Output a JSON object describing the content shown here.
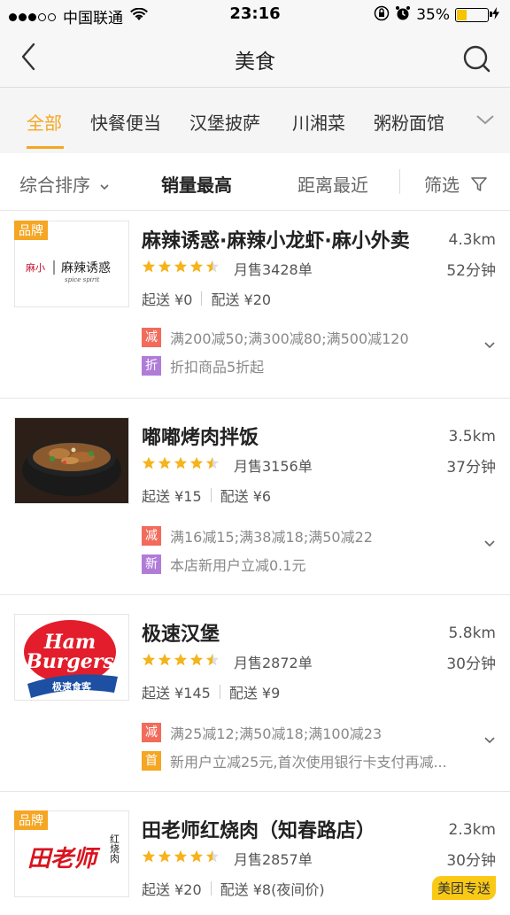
{
  "status_bar": {
    "carrier": "中国联通",
    "time": "23:16",
    "battery": "35%",
    "battery_level": 0.35
  },
  "nav": {
    "title": "美食"
  },
  "categories": [
    "全部",
    "快餐便当",
    "汉堡披萨",
    "川湘菜",
    "粥粉面馆"
  ],
  "sort": {
    "comprehensive": "综合排序",
    "sales": "销量最高",
    "distance": "距离最近",
    "filter": "筛选"
  },
  "brand_label": "品牌",
  "restaurants": [
    {
      "name": "麻辣诱惑·麻辣小龙虾·麻小外卖",
      "distance": "4.3km",
      "time": "52分钟",
      "sales": "月售3428单",
      "min_order": "起送 ¥0",
      "delivery_fee": "配送 ¥20",
      "rating": 4.5,
      "brand": true,
      "logo": {
        "left_text": "麻小",
        "right_text": "麻辣诱惑",
        "sub_text": "spice spirit"
      },
      "promos": [
        {
          "tag": "减",
          "color": "red",
          "text": "满200减50;满300减80;满500减120"
        },
        {
          "tag": "折",
          "color": "purple",
          "text": "折扣商品5折起"
        }
      ]
    },
    {
      "name": "嘟嘟烤肉拌饭",
      "distance": "3.5km",
      "time": "37分钟",
      "sales": "月售3156单",
      "min_order": "起送 ¥15",
      "delivery_fee": "配送 ¥6",
      "rating": 4.5,
      "brand": false,
      "promos": [
        {
          "tag": "减",
          "color": "red",
          "text": "满16减15;满38减18;满50减22"
        },
        {
          "tag": "新",
          "color": "purple",
          "text": "本店新用户立减0.1元"
        }
      ]
    },
    {
      "name": "极速汉堡",
      "distance": "5.8km",
      "time": "30分钟",
      "sales": "月售2872单",
      "min_order": "起送 ¥145",
      "delivery_fee": "配送 ¥9",
      "rating": 4.5,
      "brand": false,
      "logo": {
        "line1": "Ham",
        "line2": "Burgers",
        "line3": "极速食客"
      },
      "promos": [
        {
          "tag": "减",
          "color": "red",
          "text": "满25减12;满50减18;满100减23"
        },
        {
          "tag": "首",
          "color": "orange",
          "text": "新用户立减25元,首次使用银行卡支付再减..."
        }
      ]
    },
    {
      "name": "田老师红烧肉（知春路店）",
      "distance": "2.3km",
      "time": "30分钟",
      "sales": "月售2857单",
      "min_order": "起送 ¥20",
      "delivery_fee": "配送 ¥8(夜间价)",
      "rating": 4.5,
      "brand": true,
      "logo": {
        "main": "田老师",
        "side": "红烧肉"
      },
      "badge": "美团专送"
    }
  ],
  "colors": {
    "accent": "#f5a623",
    "promo_red": "#f26b5b",
    "promo_purple": "#b07cd8",
    "star": "#f5b31c"
  }
}
